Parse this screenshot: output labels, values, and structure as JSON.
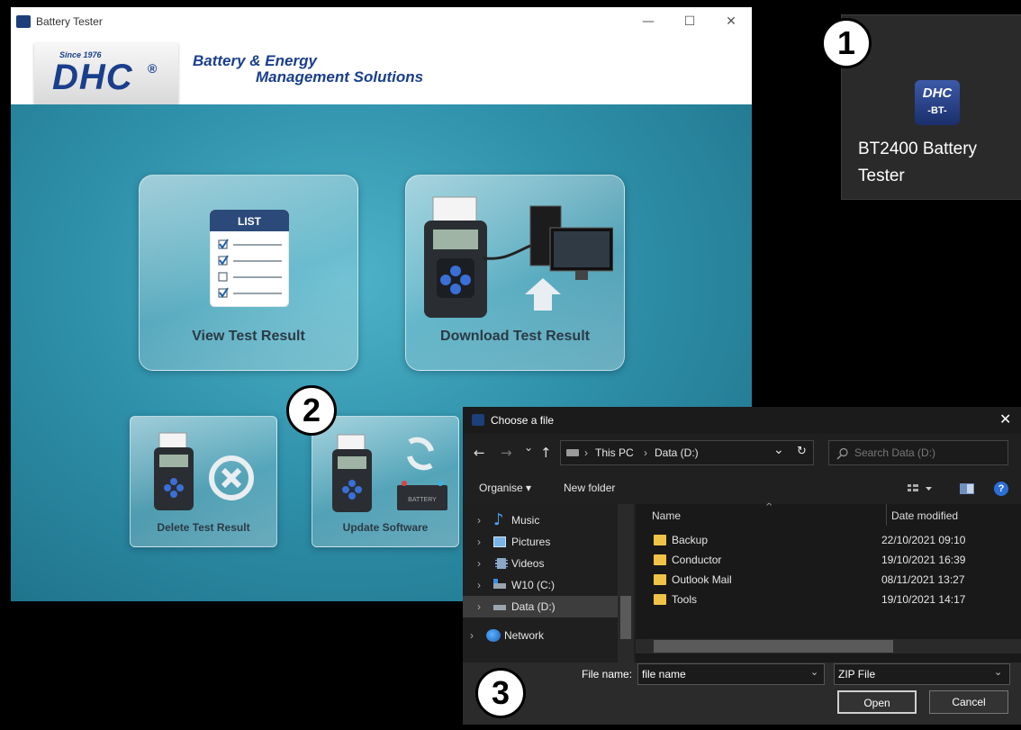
{
  "app_window": {
    "title": "Battery Tester",
    "controls": {
      "minimize": "—",
      "maximize": "☐",
      "close": "✕"
    },
    "logo": {
      "since": "Since 1976",
      "brand": "DHC",
      "reg": "®"
    },
    "tagline_1": "Battery & Energy",
    "tagline_2": "Management Solutions",
    "tiles": {
      "view_test_result": "View Test Result",
      "list_header": "LIST",
      "download_test_result": "Download Test Result",
      "delete_test_result": "Delete Test Result",
      "update_software": "Update Software",
      "battery_label": "BATTERY"
    }
  },
  "desktop_shortcut": {
    "icon_text_1": "DHC",
    "icon_text_2": "-BT-",
    "label": "BT2400 Battery Tester"
  },
  "badges": {
    "b1": "1",
    "b2": "2",
    "b3": "3"
  },
  "file_dialog": {
    "title": "Choose a file",
    "close": "✕",
    "nav": {
      "back": "←",
      "forward": "→",
      "recent": "⌄",
      "up": "↑",
      "refresh": "↻",
      "dropdown": "⌄"
    },
    "address": {
      "segment_1": "This PC",
      "separator": "›",
      "segment_2": "Data (D:)"
    },
    "search_placeholder": "Search Data (D:)",
    "toolbar": {
      "organise": "Organise ▾",
      "new_folder": "New folder",
      "help": "?"
    },
    "nav_items": [
      {
        "label": "Music"
      },
      {
        "label": "Pictures"
      },
      {
        "label": "Videos"
      },
      {
        "label": "W10 (C:)"
      },
      {
        "label": "Data (D:)"
      },
      {
        "label": "Network"
      }
    ],
    "columns": {
      "name": "Name",
      "date_modified": "Date modified"
    },
    "files": [
      {
        "name": "Backup",
        "date": "22/10/2021 09:10"
      },
      {
        "name": "Conductor",
        "date": "19/10/2021 16:39"
      },
      {
        "name": "Outlook Mail",
        "date": "08/11/2021 13:27"
      },
      {
        "name": "Tools",
        "date": "19/10/2021 14:17"
      }
    ],
    "file_name_label": "File name:",
    "file_name_value": "file name",
    "file_type": "ZIP File",
    "open_button": "Open",
    "cancel_button": "Cancel"
  },
  "colors": {
    "brand_blue": "#1a3e8c",
    "app_teal": "#2f91aa",
    "folder_yellow": "#f0c348",
    "dialog_bg": "#202020"
  }
}
